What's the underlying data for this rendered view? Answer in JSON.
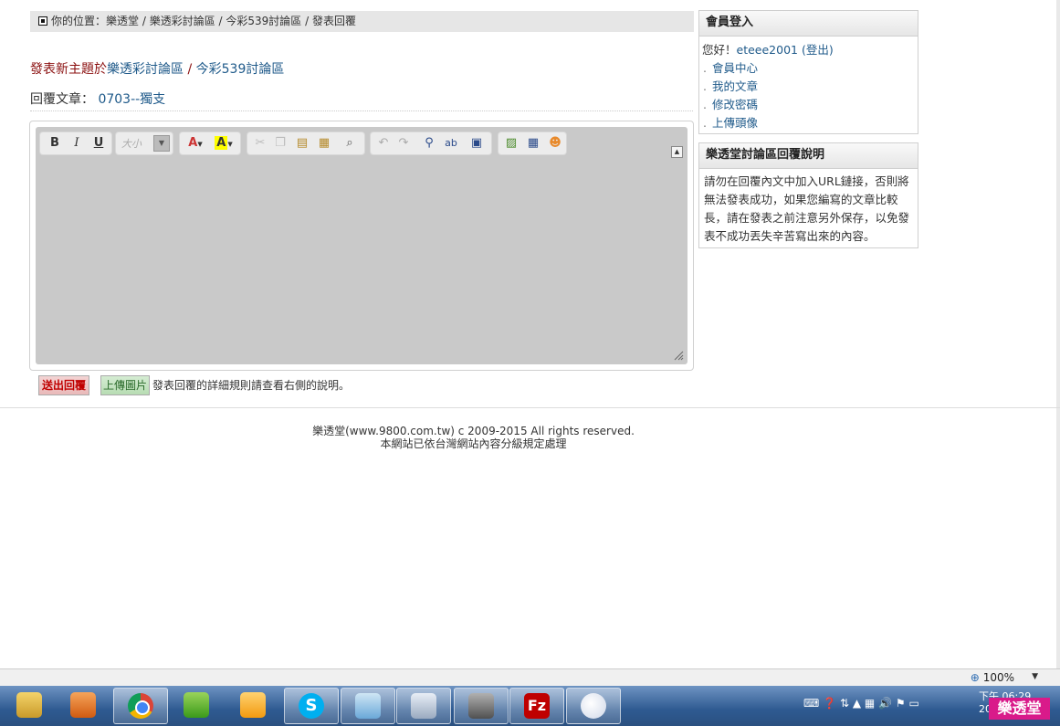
{
  "breadcrumb": {
    "prefix": "你的位置：",
    "items": [
      "樂透堂",
      "樂透彩討論區",
      "今彩539討論區",
      "發表回覆"
    ],
    "sep": " / "
  },
  "post": {
    "new_topic_label": "發表新主題於",
    "board_parent": "樂透彩討論區",
    "board_sep": " / ",
    "board": "今彩539討論區",
    "reply_label": "回覆文章：",
    "reply_title": "0703--獨支"
  },
  "editor": {
    "bold": "B",
    "italic": "I",
    "underline": "U",
    "size_placeholder": "大小",
    "font_color": "A",
    "highlight": "A"
  },
  "actions": {
    "submit": "送出回覆",
    "upload": "上傳圖片",
    "note": "發表回覆的詳細規則請查看右側的說明。"
  },
  "login_panel": {
    "title": "會員登入",
    "greeting": "您好！",
    "username": "eteee2001",
    "logout": "(登出)",
    "links": [
      "會員中心",
      "我的文章",
      "修改密碼",
      "上傳頭像"
    ]
  },
  "help_panel": {
    "title": "樂透堂討論區回覆說明",
    "body": "請勿在回覆內文中加入URL鏈接，否則將無法發表成功，如果您編寫的文章比較長，請在發表之前注意另外保存，以免發表不成功丟失辛苦寫出來的內容。"
  },
  "footer": {
    "line1": "樂透堂(www.9800.com.tw) c 2009-2015 All rights reserved.",
    "line2": "本網站已依台灣網站內容分級規定處理"
  },
  "status": {
    "zoom": "100%"
  },
  "taskbar": {
    "clock_time": "下午 06:29",
    "clock_date": "2015/...",
    "brand": "樂透堂"
  },
  "colors": {
    "link": "#1f5a8a",
    "new_topic": "#8b1010",
    "submit_text": "#c00000",
    "brand": "#d91a8a"
  }
}
